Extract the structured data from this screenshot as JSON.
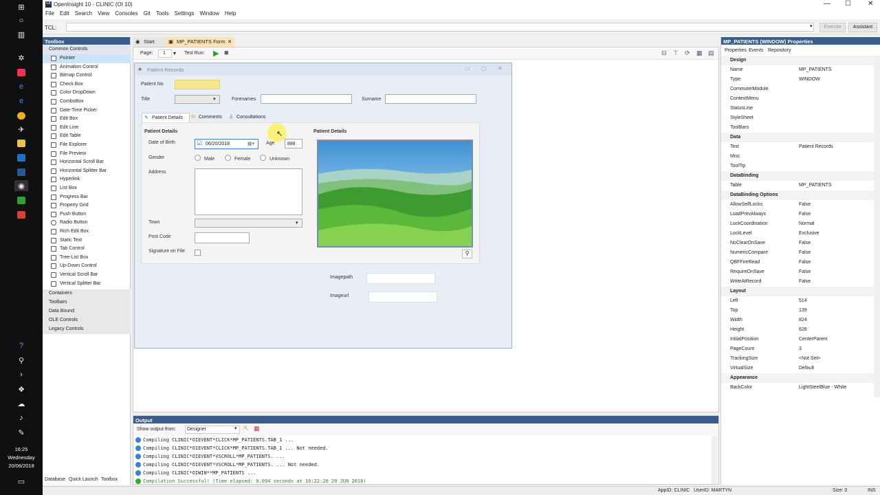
{
  "window": {
    "title": "OpenInsight 10 - CLINIC (OI 10)"
  },
  "menu": [
    "File",
    "Edit",
    "Search",
    "View",
    "Consoles",
    "Git",
    "Tools",
    "Settings",
    "Window",
    "Help"
  ],
  "tcl": {
    "label": "TCL:",
    "execute": "Execute",
    "assistant": "Assistant"
  },
  "toolbox": {
    "title": "Toolbox",
    "group_common": "Common Controls",
    "items": [
      "Pointer",
      "Animation Control",
      "Bitmap Control",
      "Check Box",
      "Color DropDown",
      "ComboBox",
      "Date-Time Picker",
      "Edit Box",
      "Edit Line",
      "Edit Table",
      "File Explorer",
      "File Preview",
      "Horizontal Scroll Bar",
      "Horizontal Splitter Bar",
      "Hyperlink",
      "List Box",
      "Progress Bar",
      "Property Grid",
      "Push Button",
      "Radio Button",
      "Rich Edit Box",
      "Static Text",
      "Tab Control",
      "Tree-List Box",
      "Up-Down Control",
      "Vertical Scroll Bar",
      "Vertical Splitter Bar"
    ],
    "groups": [
      "Containers",
      "Toolbars",
      "Data Bound",
      "OLE Controls",
      "Legacy Controls"
    ],
    "bottom_tabs": [
      "Database",
      "Quick Launch",
      "Toolbox"
    ]
  },
  "doc_tabs": {
    "start": "Start",
    "form": "MP_PATIENTS Form"
  },
  "designer_toolbar": {
    "page_label": "Page:",
    "page_value": "1",
    "test_run": "Test Run:"
  },
  "form": {
    "title": "Patient Records",
    "patient_no": "Patient No",
    "title_label": "Title",
    "forenames": "Forenames",
    "surname": "Surname",
    "tabs": [
      "Patient Details",
      "Comments",
      "Consultations"
    ],
    "section_left": "Patient Details",
    "section_right": "Patient Details",
    "dob_label": "Date of Birth",
    "dob_value": "06/20/2018",
    "age_label": "Age",
    "age_value": "888",
    "gender_label": "Gender",
    "gender_options": [
      "Male",
      "Female",
      "Unknown"
    ],
    "address": "Address",
    "town": "Town",
    "post_code": "Post Code",
    "signature": "Signature on File",
    "imagepath": "Imagepath",
    "imageurl": "Imageurl"
  },
  "output": {
    "title": "Output",
    "show_from_label": "Show output from:",
    "show_from_value": "Designer",
    "lines": [
      "Compiling CLINIC*OIEVENT*CLICK*MP_PATIENTS.TAB_1 ...",
      "Compiling CLINIC*OIEVENT*CLICK*MP_PATIENTS.TAB_1 ... Not needed.",
      "Compiling CLINIC*OIEVENT*VSCROLL*MP_PATIENTS. ...",
      "Compiling CLINIC*OIEVENT*VSCROLL*MP_PATIENTS. ... Not needed.",
      "Compiling CLINIC*OIWIN**MP_PATIENTS ...",
      "Compilation Successful! (Time elapsed: 0.094 seconds at 16:22:20  20 JUN 2018)"
    ]
  },
  "properties": {
    "title": "MP_PATIENTS (WINDOW) Properties",
    "tabs": [
      "Properties",
      "Events",
      "Repository"
    ],
    "rows": [
      {
        "s": "Design"
      },
      {
        "k": "Name",
        "v": "MP_PATIENTS"
      },
      {
        "k": "Type",
        "v": "WINDOW"
      },
      {
        "k": "CommuterModule",
        "v": ""
      },
      {
        "k": "ContextMenu",
        "v": ""
      },
      {
        "k": "StatusLine",
        "v": ""
      },
      {
        "k": "StyleSheet",
        "v": ""
      },
      {
        "k": "ToolBars",
        "v": ""
      },
      {
        "s": "Data"
      },
      {
        "k": "Text",
        "v": "Patient Records"
      },
      {
        "k": "Misc",
        "v": ""
      },
      {
        "k": "ToolTip",
        "v": ""
      },
      {
        "s": "DataBinding"
      },
      {
        "k": "Table",
        "v": "MP_PATIENTS"
      },
      {
        "s": "DataBinding Options"
      },
      {
        "k": "AllowSelfLocks",
        "v": "False"
      },
      {
        "k": "LoadPrevAlways",
        "v": "False"
      },
      {
        "k": "LockCoordination",
        "v": "Normal"
      },
      {
        "k": "LockLevel",
        "v": "Exclusive"
      },
      {
        "k": "NoClearOnSave",
        "v": "False"
      },
      {
        "k": "NumericCompare",
        "v": "False"
      },
      {
        "k": "QBFFireRead",
        "v": "False"
      },
      {
        "k": "RequireOnSave",
        "v": "False"
      },
      {
        "k": "WriteAtRecord",
        "v": "False"
      },
      {
        "s": "Layout"
      },
      {
        "k": "Left",
        "v": "514"
      },
      {
        "k": "Top",
        "v": "139"
      },
      {
        "k": "Width",
        "v": "824"
      },
      {
        "k": "Height",
        "v": "628"
      },
      {
        "k": "InitialPosition",
        "v": "CenterParent"
      },
      {
        "k": "PageCount",
        "v": "3"
      },
      {
        "k": "TrackingSize",
        "v": "<Not Set>"
      },
      {
        "k": "VirtualSize",
        "v": "Default"
      },
      {
        "s": "Appearance"
      },
      {
        "k": "BackColor",
        "v": "LightSteelBlue - White"
      }
    ]
  },
  "statusbar": {
    "appid": "AppID: CLINIC",
    "userid": "UserID: MARTYN",
    "size": "Size: 0",
    "ins": "INS"
  },
  "clock": {
    "time": "16:25",
    "day": "Wednesday",
    "date": "20/06/2018"
  }
}
